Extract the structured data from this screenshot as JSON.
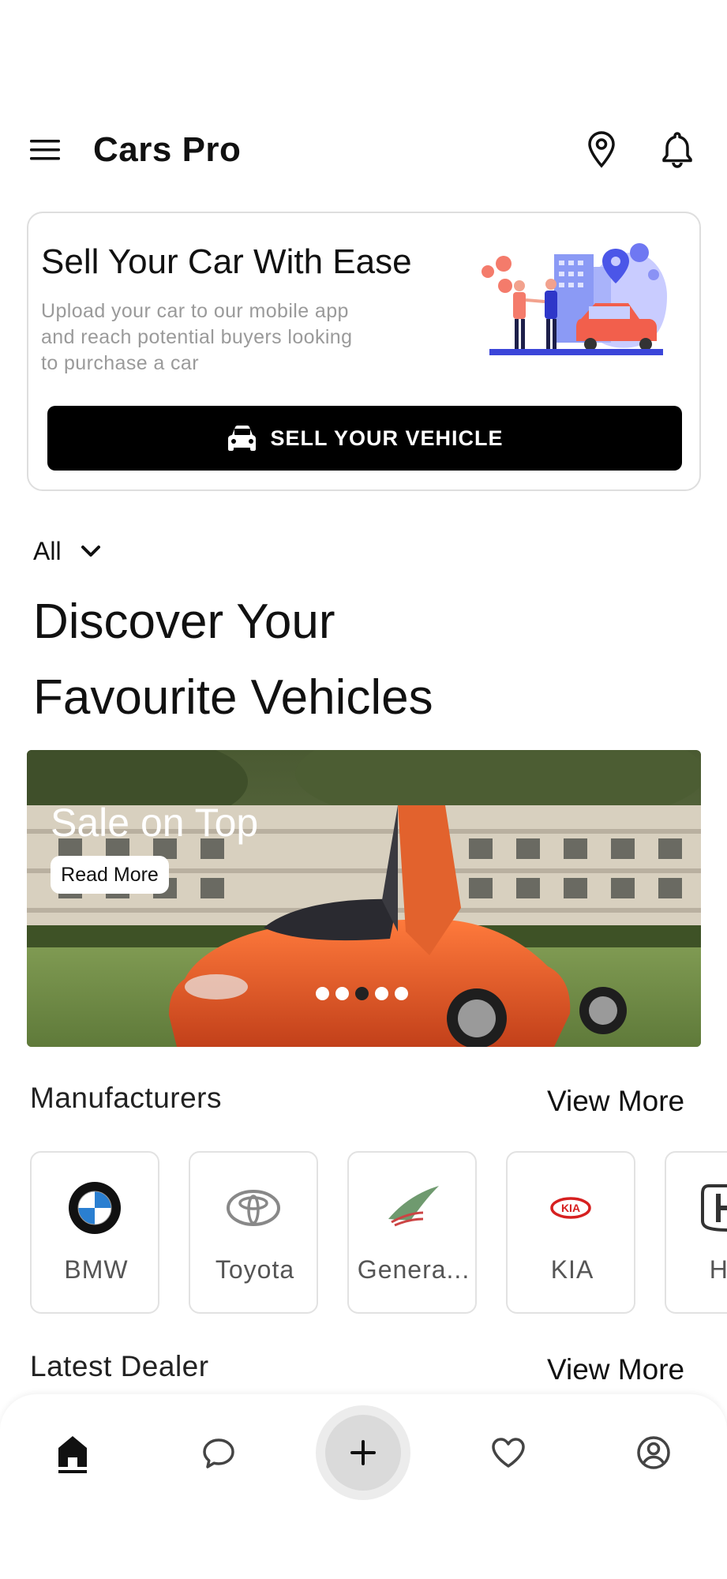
{
  "app": {
    "title": "Cars Pro"
  },
  "icons": {
    "menu": "menu-icon",
    "location": "location-pin-icon",
    "notifications": "bell-icon",
    "car": "car-icon",
    "chevron": "chevron-down-icon",
    "home": "home-icon",
    "chat": "chat-icon",
    "add": "plus-icon",
    "favorites": "heart-icon",
    "profile": "user-circle-icon"
  },
  "sell_card": {
    "title": "Sell Your Car With Ease",
    "description": "Upload your car to our mobile app and reach potential buyers looking to purchase a car",
    "button_label": "SELL YOUR VEHICLE"
  },
  "filter": {
    "selected": "All"
  },
  "discover": {
    "line1": "Discover Your",
    "line2": "Favourite Vehicles"
  },
  "banner": {
    "title": "Sale on Top",
    "button_label": "Read More",
    "slides": 5,
    "active_slide": 3
  },
  "manufacturers": {
    "title": "Manufacturers",
    "view_more": "View More",
    "items": [
      {
        "name": "BMW"
      },
      {
        "name": "Toyota"
      },
      {
        "name": "Genera..."
      },
      {
        "name": "KIA"
      },
      {
        "name": "Hor"
      }
    ]
  },
  "latest_dealer": {
    "title": "Latest Dealer",
    "view_more": "View More"
  },
  "colors": {
    "accent": "#000000",
    "card_border": "#dedede",
    "muted_text": "#9a9a9a",
    "banner_car": "#e8542a"
  }
}
